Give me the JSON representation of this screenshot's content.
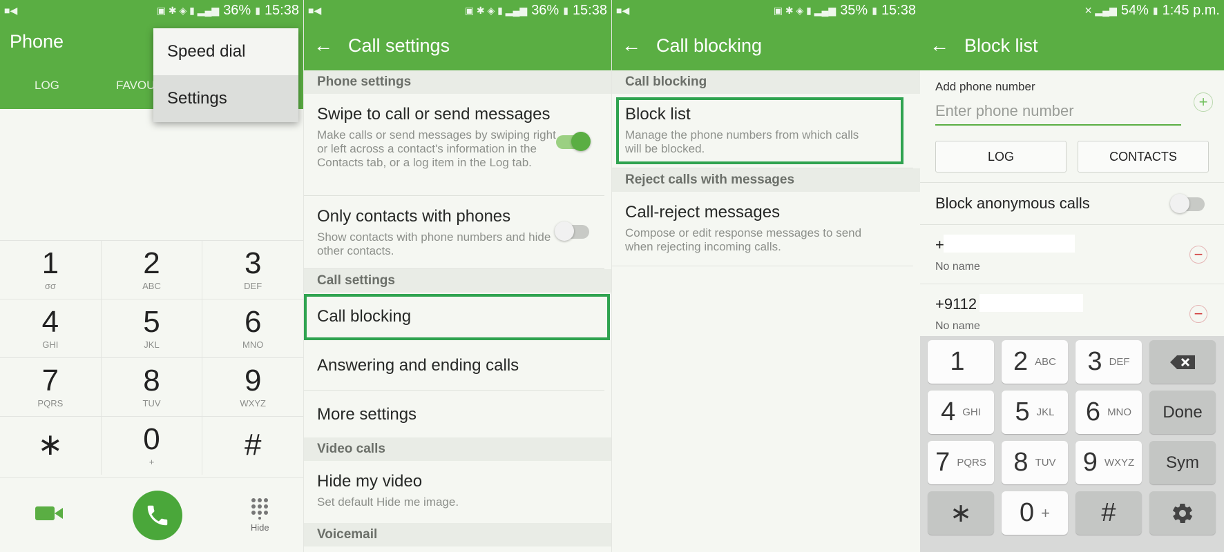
{
  "panel1": {
    "status": {
      "battery": "36%",
      "time": "15:38"
    },
    "title": "Phone",
    "tabs": [
      "LOG",
      "FAVOU"
    ],
    "menu": [
      "Speed dial",
      "Settings"
    ],
    "keys": [
      [
        {
          "d": "1",
          "l": "σσ"
        },
        {
          "d": "2",
          "l": "ABC"
        },
        {
          "d": "3",
          "l": "DEF"
        }
      ],
      [
        {
          "d": "4",
          "l": "GHI"
        },
        {
          "d": "5",
          "l": "JKL"
        },
        {
          "d": "6",
          "l": "MNO"
        }
      ],
      [
        {
          "d": "7",
          "l": "PQRS"
        },
        {
          "d": "8",
          "l": "TUV"
        },
        {
          "d": "9",
          "l": "WXYZ"
        }
      ],
      [
        {
          "d": "∗",
          "l": ""
        },
        {
          "d": "0",
          "l": "+"
        },
        {
          "d": "#",
          "l": ""
        }
      ]
    ],
    "hide_label": "Hide",
    "accent": "#5aae43"
  },
  "panel2": {
    "status": {
      "battery": "36%",
      "time": "15:38"
    },
    "title": "Call settings",
    "sections": {
      "phone": "Phone settings",
      "call": "Call settings",
      "video": "Video calls",
      "voicemail": "Voicemail"
    },
    "swipe": {
      "title": "Swipe to call or send messages",
      "desc": "Make calls or send messages by swiping right or left across a contact's information in the Contacts tab, or a log item in the Log tab.",
      "on": true
    },
    "only_contacts": {
      "title": "Only contacts with phones",
      "desc": "Show contacts with phone numbers and hide other contacts.",
      "on": false
    },
    "call_blocking": "Call blocking",
    "answering": "Answering and ending calls",
    "more": "More settings",
    "hide_video": {
      "title": "Hide my video",
      "desc": "Set default Hide me image."
    }
  },
  "panel3": {
    "status": {
      "battery": "35%",
      "time": "15:38"
    },
    "title": "Call blocking",
    "section1": "Call blocking",
    "block_list": {
      "title": "Block list",
      "desc": "Manage the phone numbers from which calls will be blocked."
    },
    "section2": "Reject calls with messages",
    "reject": {
      "title": "Call-reject messages",
      "desc": "Compose or edit response messages to send when rejecting incoming calls."
    }
  },
  "panel4": {
    "status": {
      "battery": "54%",
      "time": "1:45 p.m."
    },
    "title": "Block list",
    "add_label": "Add phone number",
    "placeholder": "Enter phone number",
    "log_button": "LOG",
    "contacts_button": "CONTACTS",
    "anonymous": "Block anonymous calls",
    "entries": [
      {
        "number": "+",
        "name": "No name"
      },
      {
        "number": "+9112",
        "name": "No name"
      }
    ],
    "keyboard": [
      [
        {
          "d": "1",
          "l": ""
        },
        {
          "d": "2",
          "l": "ABC"
        },
        {
          "d": "3",
          "l": "DEF"
        }
      ],
      [
        {
          "d": "4",
          "l": "GHI"
        },
        {
          "d": "5",
          "l": "JKL"
        },
        {
          "d": "6",
          "l": "MNO"
        }
      ],
      [
        {
          "d": "7",
          "l": "PQRS"
        },
        {
          "d": "8",
          "l": "TUV"
        },
        {
          "d": "9",
          "l": "WXYZ"
        }
      ],
      [
        {
          "d": "∗",
          "l": ""
        },
        {
          "d": "0",
          "l": "+"
        },
        {
          "d": "#",
          "l": ""
        }
      ]
    ],
    "done": "Done",
    "sym": "Sym"
  }
}
